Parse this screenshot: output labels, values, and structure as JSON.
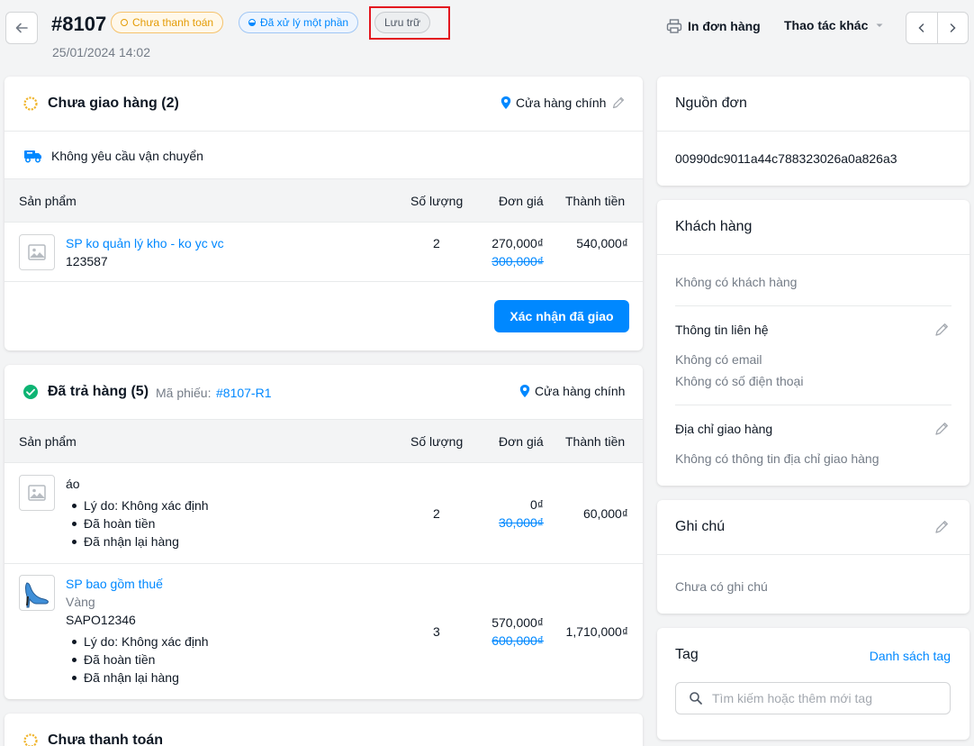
{
  "header": {
    "order_number": "#8107",
    "order_date": "25/01/2024 14:02",
    "badges": {
      "payment": "Chưa thanh toán",
      "processing": "Đã xử lý một phần",
      "archive": "Lưu trữ"
    },
    "print_label": "In đơn hàng",
    "more_actions_label": "Thao tác khác"
  },
  "unfulfilled": {
    "title": "Chưa giao hàng (2)",
    "location": "Cửa hàng chính",
    "shipping_note": "Không yêu cầu vận chuyển",
    "columns": [
      "Sản phẩm",
      "Số lượng",
      "Đơn giá",
      "Thành tiền"
    ],
    "items": [
      {
        "name": "SP ko quản lý kho - ko yc vc",
        "sku": "123587",
        "qty": "2",
        "price": "270,000₫",
        "orig_price": "300,000₫",
        "total": "540,000₫"
      }
    ],
    "confirm_label": "Xác nhận đã giao"
  },
  "returned": {
    "title": "Đã trả hàng (5)",
    "ticket_label": "Mã phiếu:",
    "ticket_code": "#8107-R1",
    "location": "Cửa hàng chính",
    "columns": [
      "Sản phẩm",
      "Số lượng",
      "Đơn giá",
      "Thành tiền"
    ],
    "items": [
      {
        "name": "áo",
        "notes": [
          "Lý do: Không xác định",
          "Đã hoàn tiền",
          "Đã nhận lại hàng"
        ],
        "qty": "2",
        "price": "0₫",
        "orig_price": "30,000₫",
        "total": "60,000₫"
      },
      {
        "name": "SP bao gồm thuế",
        "variant": "Vàng",
        "sku": "SAPO12346",
        "notes": [
          "Lý do: Không xác định",
          "Đã hoàn tiền",
          "Đã nhận lại hàng"
        ],
        "qty": "3",
        "price": "570,000₫",
        "orig_price": "600,000₫",
        "total": "1,710,000₫"
      }
    ]
  },
  "unpaid": {
    "title": "Chưa thanh toán"
  },
  "source": {
    "title": "Nguồn đơn",
    "value": "00990dc9011a44c788323026a0a826a3"
  },
  "customer": {
    "title": "Khách hàng",
    "empty": "Không có khách hàng",
    "contact_title": "Thông tin liên hệ",
    "no_email": "Không có email",
    "no_phone": "Không có số điện thoại",
    "address_title": "Địa chỉ giao hàng",
    "no_address": "Không có thông tin địa chỉ giao hàng"
  },
  "note": {
    "title": "Ghi chú",
    "empty": "Chưa có ghi chú"
  },
  "tags": {
    "title": "Tag",
    "list_link": "Danh sách tag",
    "placeholder": "Tìm kiếm hoặc thêm mới tag"
  },
  "colors": {
    "primary": "#0088ff",
    "warning": "#e49c06",
    "success": "#0db473",
    "highlight": "#e3161f"
  },
  "icons": [
    "back-arrow-icon",
    "printer-icon",
    "chevron-down-icon",
    "chevron-left-icon",
    "chevron-right-icon",
    "pending-sun-icon",
    "location-pin-icon",
    "edit-pencil-icon",
    "truck-icon",
    "image-placeholder-icon",
    "check-circle-icon",
    "search-icon"
  ]
}
